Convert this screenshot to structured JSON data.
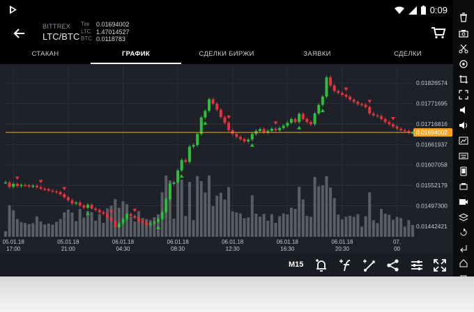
{
  "status": {
    "time": "0:09"
  },
  "header": {
    "exchange": "BITTREX",
    "pair": "LTC/BTC",
    "quotes": [
      {
        "label": "Тек",
        "value": "0.01694002"
      },
      {
        "label": "LTC",
        "value": "1.47014527"
      },
      {
        "label": "BTC",
        "value": "0.0118783"
      }
    ]
  },
  "tabs": [
    {
      "label": "СТАКАН"
    },
    {
      "label": "ГРАФИК"
    },
    {
      "label": "СДЕЛКИ БИРЖИ"
    },
    {
      "label": "ЗАЯВКИ"
    },
    {
      "label": "СДЕЛКИ"
    }
  ],
  "toolbar": {
    "timeframe": "M15"
  },
  "icons": {
    "status_logo": "app-logo-icon",
    "back": "arrow-left-icon",
    "cart": "cart-icon",
    "toolbar": [
      "bell-plus-icon",
      "indicator-icon",
      "trendline-icon",
      "share-icon",
      "settings-sliders-icon",
      "fullscreen-icon"
    ],
    "sidebar": [
      "trash-icon",
      "camera-icon",
      "scissors-icon",
      "location-icon",
      "crop-icon",
      "expand-icon",
      "volume-down-icon",
      "volume-up-icon",
      "resolution-icon",
      "keyboard-icon",
      "phone-icon",
      "battery-icon",
      "video-icon",
      "layers-icon",
      "rotate-icon",
      "back-icon",
      "home-icon",
      "square-icon",
      "more-icon"
    ]
  },
  "colors": {
    "up": "#2ebd3d",
    "down": "#e0343f",
    "current_line": "#f5a623",
    "volume": "#5a5d63"
  },
  "chart_data": {
    "type": "candlestick",
    "y_ticks": [
      "0.01826574",
      "0.01771695",
      "0.01716816",
      "0.01661937",
      "0.01607058",
      "0.01552179",
      "0.01497300",
      "0.01442421"
    ],
    "ylim": [
      0.01414,
      0.0187
    ],
    "current_price": "0.01694002",
    "current_value": 0.01694,
    "x_ticks": [
      {
        "date": "05.01.18",
        "time": "17:00",
        "index": 2
      },
      {
        "date": "05.01.18",
        "time": "21:00",
        "index": 16
      },
      {
        "date": "06.01.18",
        "time": "04:30",
        "index": 30
      },
      {
        "date": "06.01.18",
        "time": "08:30",
        "index": 44
      },
      {
        "date": "06.01.18",
        "time": "12:30",
        "index": 58
      },
      {
        "date": "06.01.18",
        "time": "16:30",
        "index": 72
      },
      {
        "date": "06.01.18",
        "time": "20:30",
        "index": 86
      },
      {
        "date": "07.",
        "time": "00",
        "index": 100
      }
    ],
    "closes": [
      0.0156,
      0.01548,
      0.01556,
      0.0155,
      0.01553,
      0.01552,
      0.01549,
      0.01551,
      0.01547,
      0.01543,
      0.01542,
      0.01538,
      0.01536,
      0.01534,
      0.01528,
      0.0152,
      0.01512,
      0.01503,
      0.01506,
      0.01498,
      0.01492,
      0.015,
      0.0149,
      0.01486,
      0.0148,
      0.01476,
      0.01466,
      0.01456,
      0.0144,
      0.0145,
      0.01462,
      0.01475,
      0.0147,
      0.01465,
      0.01456,
      0.01452,
      0.01446,
      0.0145,
      0.01454,
      0.01462,
      0.0148,
      0.01515,
      0.01556,
      0.0156,
      0.01592,
      0.0162,
      0.01615,
      0.01656,
      0.0166,
      0.0169,
      0.01734,
      0.01752,
      0.01783,
      0.01771,
      0.01755,
      0.01735,
      0.0172,
      0.017,
      0.0169,
      0.01682,
      0.01676,
      0.0167,
      0.01675,
      0.0169,
      0.01698,
      0.01703,
      0.01694,
      0.01698,
      0.01704,
      0.017,
      0.01706,
      0.01712,
      0.0172,
      0.0173,
      0.01722,
      0.01744,
      0.0173,
      0.01722,
      0.01716,
      0.01745,
      0.01768,
      0.0179,
      0.01842,
      0.0182,
      0.01805,
      0.018,
      0.01795,
      0.0179,
      0.01782,
      0.01776,
      0.0177,
      0.01768,
      0.01762,
      0.01745,
      0.0174,
      0.01738,
      0.0173,
      0.01722,
      0.01716,
      0.0171,
      0.01704,
      0.017,
      0.01698,
      0.01694,
      0.01694
    ]
  }
}
